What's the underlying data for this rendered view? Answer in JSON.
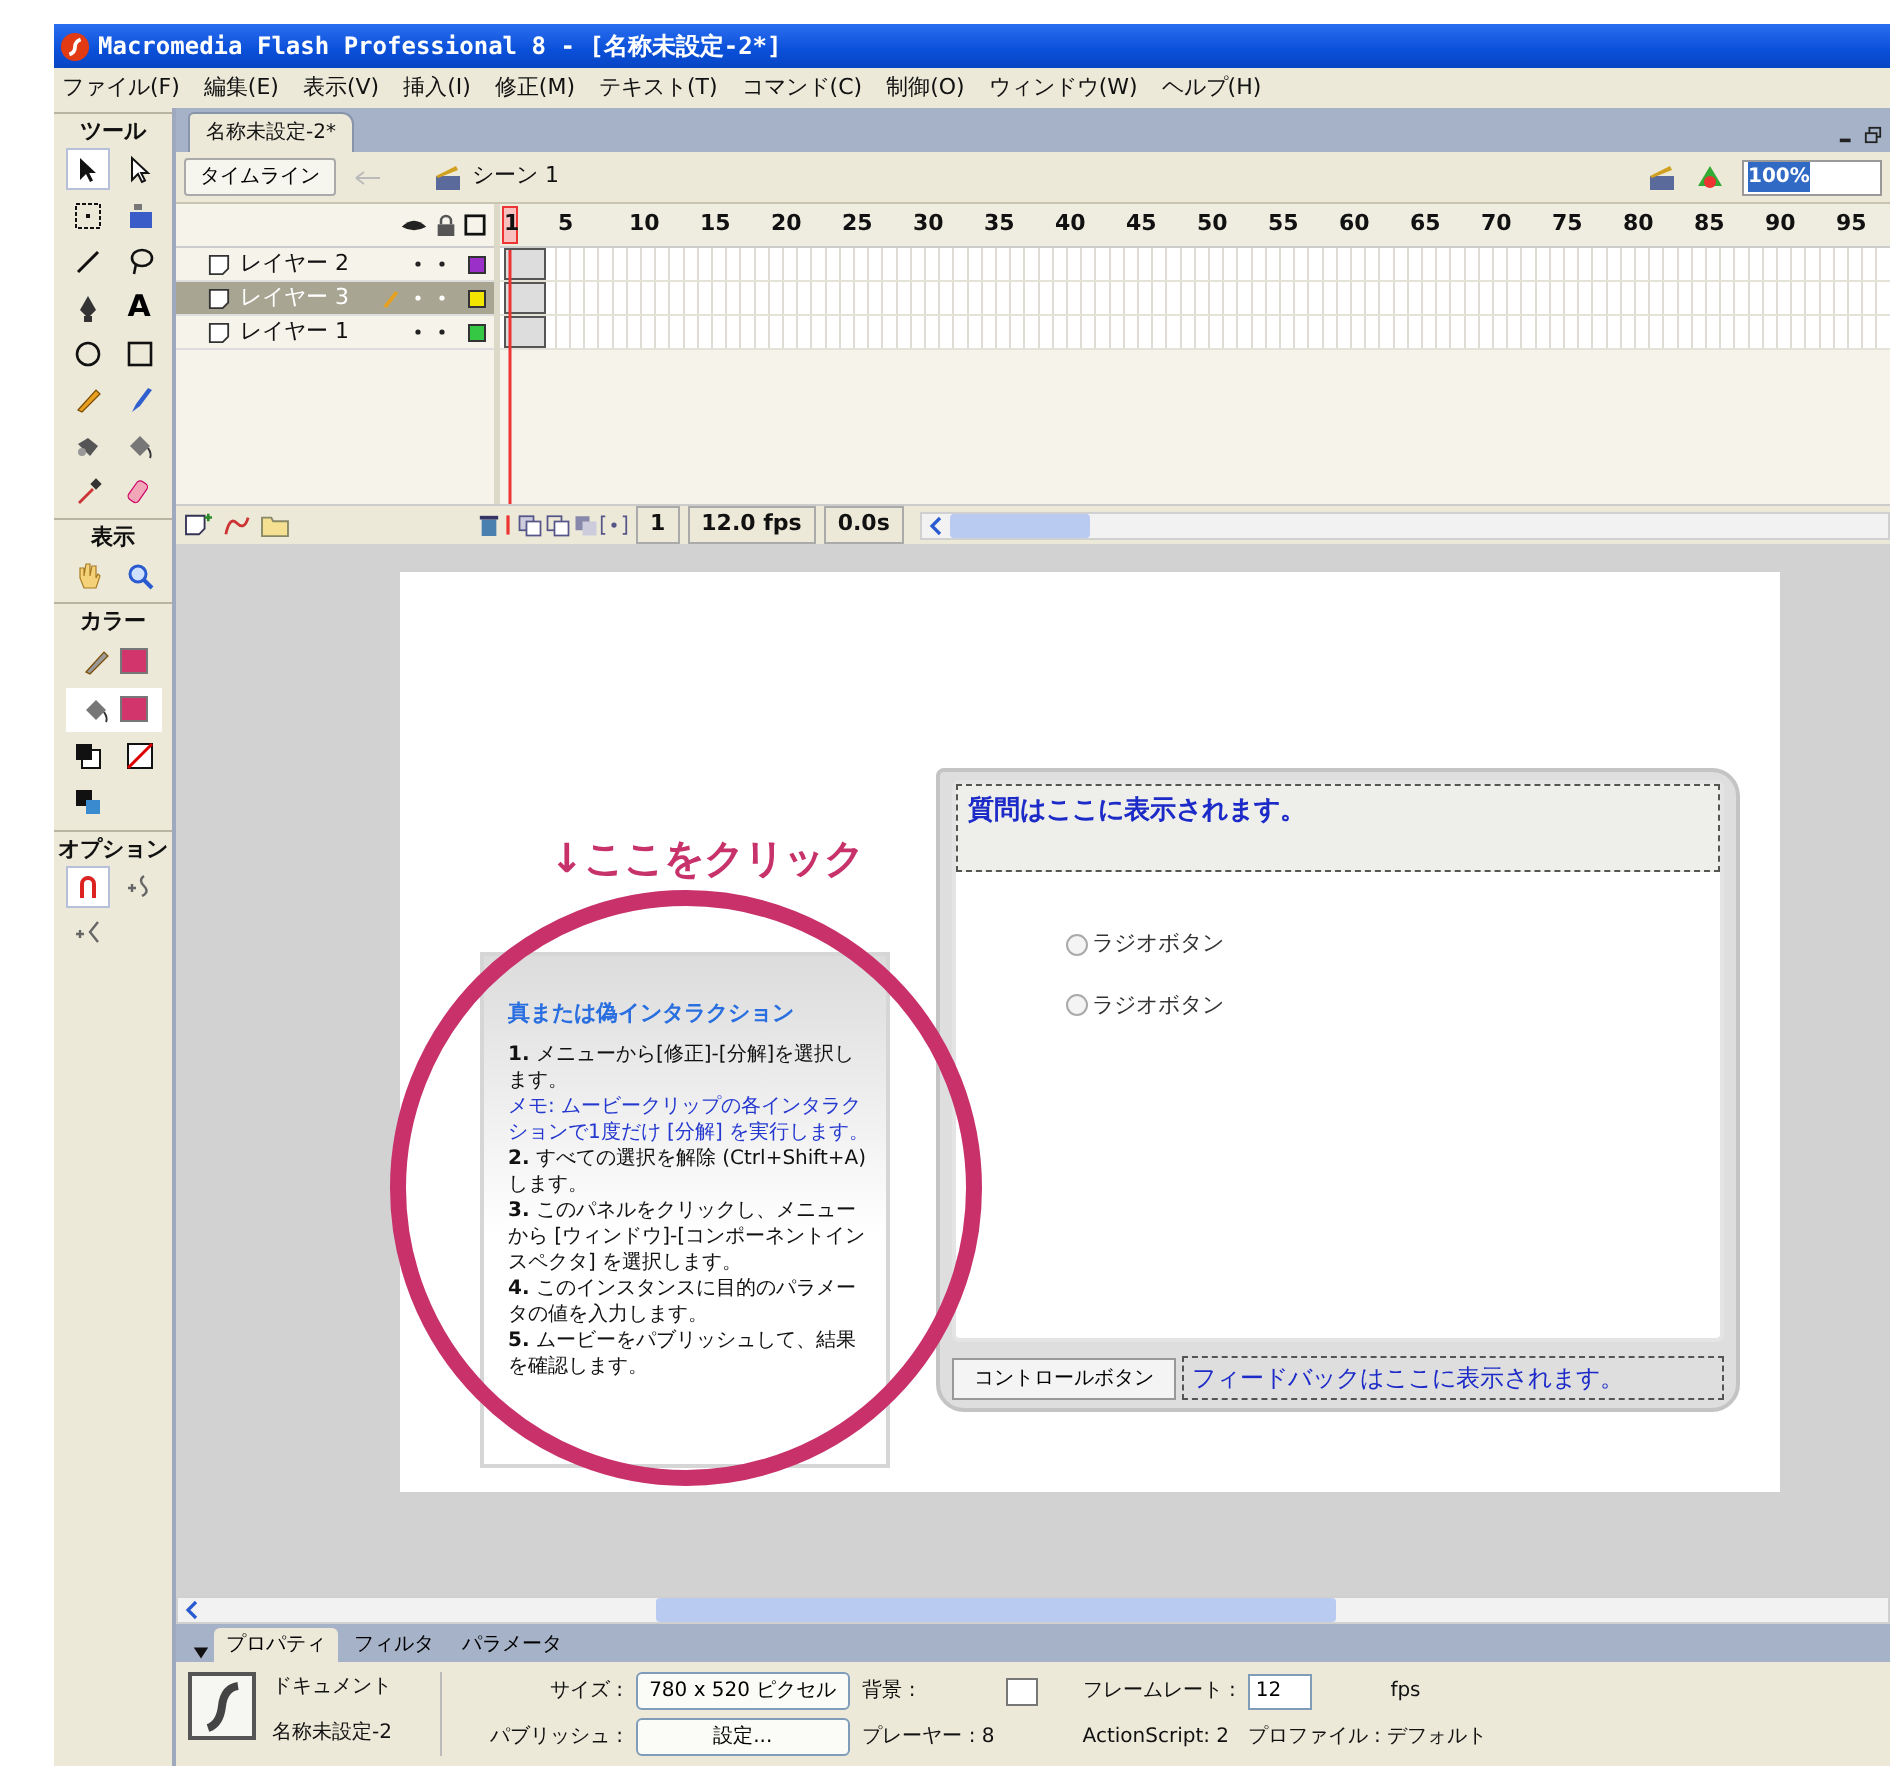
{
  "window": {
    "title": "Macromedia Flash Professional 8 - [名称未設定-2*]"
  },
  "menu": [
    "ファイル(F)",
    "編集(E)",
    "表示(V)",
    "挿入(I)",
    "修正(M)",
    "テキスト(T)",
    "コマンド(C)",
    "制御(O)",
    "ウィンドウ(W)",
    "ヘルプ(H)"
  ],
  "toolbox": [
    {
      "title": "ツール",
      "tools": [
        {
          "kind": "arrow",
          "selected": true
        },
        {
          "kind": "subselect",
          "selected": false
        },
        {
          "kind": "freetransform",
          "selected": false
        },
        {
          "kind": "filltransform",
          "selected": false
        },
        {
          "kind": "line",
          "selected": false
        },
        {
          "kind": "lasso",
          "selected": false
        },
        {
          "kind": "pen",
          "selected": false
        },
        {
          "kind": "text",
          "label": "A",
          "selected": false
        },
        {
          "kind": "oval",
          "selected": false
        },
        {
          "kind": "rect",
          "selected": false
        },
        {
          "kind": "pencil",
          "selected": false
        },
        {
          "kind": "brush",
          "selected": false
        },
        {
          "kind": "inkbottle",
          "selected": false
        },
        {
          "kind": "bucket",
          "selected": false
        },
        {
          "kind": "eyedropper",
          "selected": false
        },
        {
          "kind": "eraser",
          "selected": false
        }
      ]
    },
    {
      "title": "表示",
      "tools": [
        {
          "kind": "hand",
          "selected": false
        },
        {
          "kind": "zoom",
          "selected": false
        }
      ]
    },
    {
      "title": "カラー",
      "tools": [
        {
          "kind": "stroke-color",
          "color": "#d2356b",
          "selected": false
        },
        {
          "kind": "fill-color",
          "color": "#d2356b",
          "selected": true
        },
        {
          "kind": "default-colors",
          "selected": false
        },
        {
          "kind": "no-color",
          "selected": false
        },
        {
          "kind": "swap",
          "selected": false
        }
      ]
    },
    {
      "title": "オプション",
      "tools": [
        {
          "kind": "snap",
          "selected": true
        },
        {
          "kind": "smooth",
          "selected": false
        },
        {
          "kind": "straighten",
          "selected": false
        }
      ]
    }
  ],
  "document_tab": "名称未設定-2*",
  "edit_bar": {
    "timeline_button": "タイムライン",
    "scene": "シーン 1",
    "zoom": "100%"
  },
  "timeline": {
    "ruler": [
      "1",
      "5",
      "10",
      "15",
      "20",
      "25",
      "30",
      "35",
      "40",
      "45",
      "50",
      "55",
      "60",
      "65",
      "70",
      "75",
      "80",
      "85",
      "90",
      "95"
    ],
    "layers": [
      {
        "name": "レイヤー 2",
        "selected": false,
        "color": "#9b30c8"
      },
      {
        "name": "レイヤー 3",
        "selected": true,
        "color": "#f2e600"
      },
      {
        "name": "レイヤー 1",
        "selected": false,
        "color": "#35c845"
      }
    ],
    "current_frame": "1",
    "frame_rate": "12.0 fps",
    "elapsed": "0.0s"
  },
  "stage": {
    "hint": "↓ここをクリック",
    "panel": {
      "title": "真または偽インタラクション",
      "steps": [
        {
          "kind": "step",
          "text": "**1.** メニューから[修正]-[分解]を選択します。"
        },
        {
          "kind": "note",
          "text": "メモ: ムービークリップの各インタラクションで1度だけ [分解] を実行します。"
        },
        {
          "kind": "step",
          "text": "**2.** すべての選択を解除 (Ctrl+Shift+A) します。"
        },
        {
          "kind": "step",
          "text": "**3.** このパネルをクリックし、メニューから [ウィンドウ]-[コンポーネントインスペクタ] を選択します。"
        },
        {
          "kind": "step",
          "text": "**4.** このインスタンスに目的のパラメータの値を入力します。"
        },
        {
          "kind": "step",
          "text": "**5.** ムービーをパブリッシュして、結果を確認します。"
        }
      ]
    },
    "question": "質問はここに表示されます。",
    "options": [
      {
        "label": "ラジオボタン",
        "checked": false
      },
      {
        "label": "ラジオボタン",
        "checked": false
      }
    ],
    "control_button": "コントロールボタン",
    "feedback": "フィードバックはここに表示されます。"
  },
  "properties": {
    "tabs": [
      {
        "label": "プロパティ",
        "selected": true
      },
      {
        "label": "フィルタ",
        "selected": false
      },
      {
        "label": "パラメータ",
        "selected": false
      }
    ],
    "doc_type": "ドキュメント",
    "doc_name": "名称未設定-2",
    "size_label": "サイズ :",
    "size_button": "780 x 520 ピクセル",
    "background_label": "背景 :",
    "frame_rate_label": "フレームレート :",
    "frame_rate": "12",
    "frame_rate_unit": "fps",
    "publish_label": "パブリッシュ :",
    "publish_button": "設定...",
    "player": "プレーヤー : 8",
    "actionscript": "ActionScript: 2",
    "profile": "プロファイル : デフォルト"
  }
}
